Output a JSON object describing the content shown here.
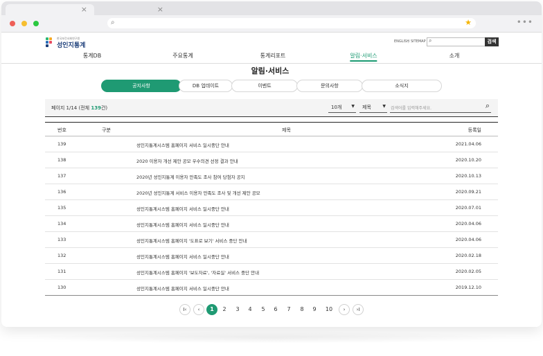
{
  "browser": {
    "tabs": [
      {
        "close": "×"
      },
      {
        "close": "×"
      }
    ]
  },
  "site": {
    "logo_small": "한국보건사회연구원",
    "logo_title": "성인지통계",
    "util_links": [
      "ENGLISH",
      "SITEMAP"
    ],
    "search_button": "검색"
  },
  "gnb": [
    "통계DB",
    "주요통계",
    "통계리포트",
    "알림·서비스",
    "소개"
  ],
  "page_title": "알림·서비스",
  "subtabs": [
    "공지사항",
    "DB 업데이트",
    "이벤트",
    "문의사항",
    "소식지"
  ],
  "filter": {
    "count_prefix": "페이지 1/14 (전체 ",
    "count_num": "139",
    "count_suffix": "건)",
    "page_size": "10개",
    "field": "제목",
    "placeholder": "검색어를 입력해주세요."
  },
  "table": {
    "headers": {
      "num": "번호",
      "cat": "구분",
      "title": "제목",
      "date": "등록일"
    },
    "rows": [
      {
        "num": "139",
        "title": "성인지통계시스템 홈페이지 서비스 일시중단 안내",
        "date": "2021.04.06"
      },
      {
        "num": "138",
        "title": "2020 이용자 개선 제안 공모 우수의견 선정 결과 안내",
        "date": "2020.10.20"
      },
      {
        "num": "137",
        "title": "2020년 성인지통계 이용자 만족도 조사 참여 당첨자 공지",
        "date": "2020.10.13"
      },
      {
        "num": "136",
        "title": "2020년 성인지통계 서비스 이용자 만족도 조사 및 개선 제안 공모",
        "date": "2020.09.21"
      },
      {
        "num": "135",
        "title": "성인지통계시스템 홈페이지 서비스 일시중단 안내",
        "date": "2020.07.01"
      },
      {
        "num": "134",
        "title": "성인지통계시스템 홈페이지 서비스 일시중단 안내",
        "date": "2020.04.06"
      },
      {
        "num": "133",
        "title": "성인지통계시스템 홈페이지 '도표로 보기' 서비스 중단 안내",
        "date": "2020.04.06"
      },
      {
        "num": "132",
        "title": "성인지통계시스템 홈페이지 서비스 일시중단 안내",
        "date": "2020.02.18"
      },
      {
        "num": "131",
        "title": "성인지통계시스템 홈페이지 '보도자료', '자료실' 서비스 중단 안내",
        "date": "2020.02.05"
      },
      {
        "num": "130",
        "title": "성인지통계시스템 홈페이지 서비스 일시중단 안내",
        "date": "2019.12.10"
      }
    ]
  },
  "pagination": {
    "first": "I‹",
    "prev": "‹",
    "pages": [
      "1",
      "2",
      "3",
      "4",
      "5",
      "6",
      "7",
      "8",
      "9",
      "10"
    ],
    "next": "›",
    "last": "›I"
  },
  "colors": {
    "accent": "#1f9a73",
    "logo": "#1d3f7a"
  }
}
